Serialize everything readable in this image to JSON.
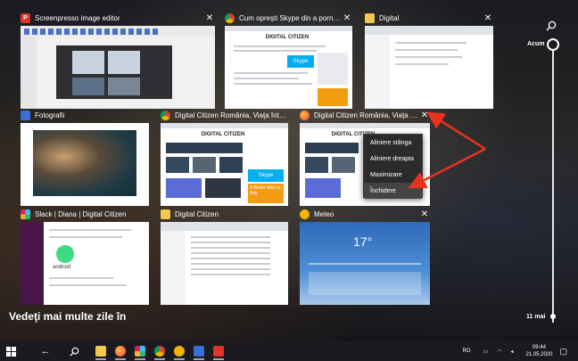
{
  "windows": [
    {
      "title": "Screenpresso image editor",
      "icon": "screenpresso-icon",
      "color": "#e4322b"
    },
    {
      "title": "Cum opreşti Skype din a porni automa...",
      "icon": "chrome-icon",
      "color": "#4285f4"
    },
    {
      "title": "Digital",
      "icon": "folder-icon",
      "color": "#f2c94c"
    },
    {
      "title": "Fotografii",
      "icon": "photos-icon",
      "color": "#3a6fd8"
    },
    {
      "title": "Digital Citizen România, Viaţa într-o lu...",
      "icon": "chrome-icon",
      "color": "#4285f4"
    },
    {
      "title": "Digital Citizen România, Viaţa într-o lu...",
      "icon": "firefox-icon",
      "color": "#ff7139"
    },
    {
      "title": "Slack | Diana | Digital Citizen",
      "icon": "slack-icon",
      "color": "#4a154b"
    },
    {
      "title": "Digital Citizen",
      "icon": "folder-icon",
      "color": "#f2c94c"
    },
    {
      "title": "Meteo",
      "icon": "weather-icon",
      "color": "#f5b400"
    }
  ],
  "thumb_text": {
    "brand": "DIGITAL CITIZEN",
    "skype": "Skype",
    "promo": "A Better Way to Buy",
    "android": "android",
    "temp": "17°"
  },
  "context_menu": {
    "items": [
      "Aliniere stânga",
      "Aliniere dreapta",
      "Maximizare",
      "Închidere"
    ]
  },
  "timeline": {
    "now_label": "Acum",
    "date_label": "11 mai"
  },
  "more_days": "Vedeţi mai multe zile în",
  "taskbar": {
    "language": "RO",
    "time": "09:44",
    "date": "21.05.2020"
  },
  "colors": {
    "accent": "#4285f4",
    "arrow": "#e8321e"
  }
}
